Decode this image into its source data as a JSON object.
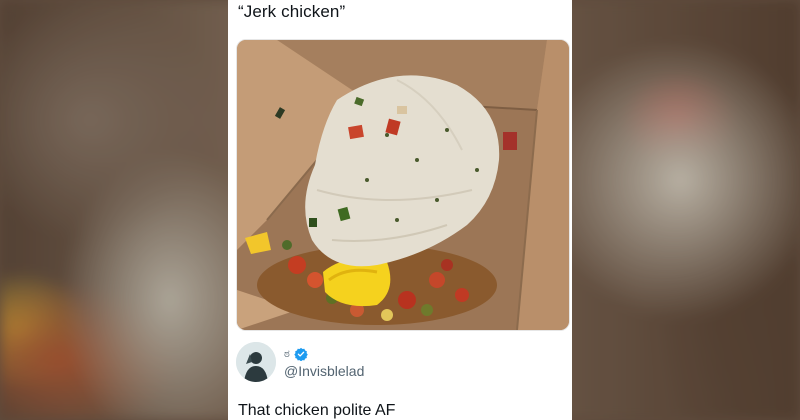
{
  "post": {
    "text": "“Jerk chicken”",
    "image_alt_subject": "pale chicken breast with diced peppers in a kraft takeout box"
  },
  "reply": {
    "display_name": "ಠ",
    "handle": "@Invisblelad",
    "verified": true,
    "text": "That chicken polite AF"
  },
  "icons": {
    "verified": "verified-badge-icon",
    "avatar": "user-avatar"
  },
  "colors": {
    "text_primary": "#0f1419",
    "text_secondary": "#536471",
    "verified_blue": "#1d9bf0",
    "card_bg": "#ffffff",
    "box_kraft": "#c29a74"
  }
}
